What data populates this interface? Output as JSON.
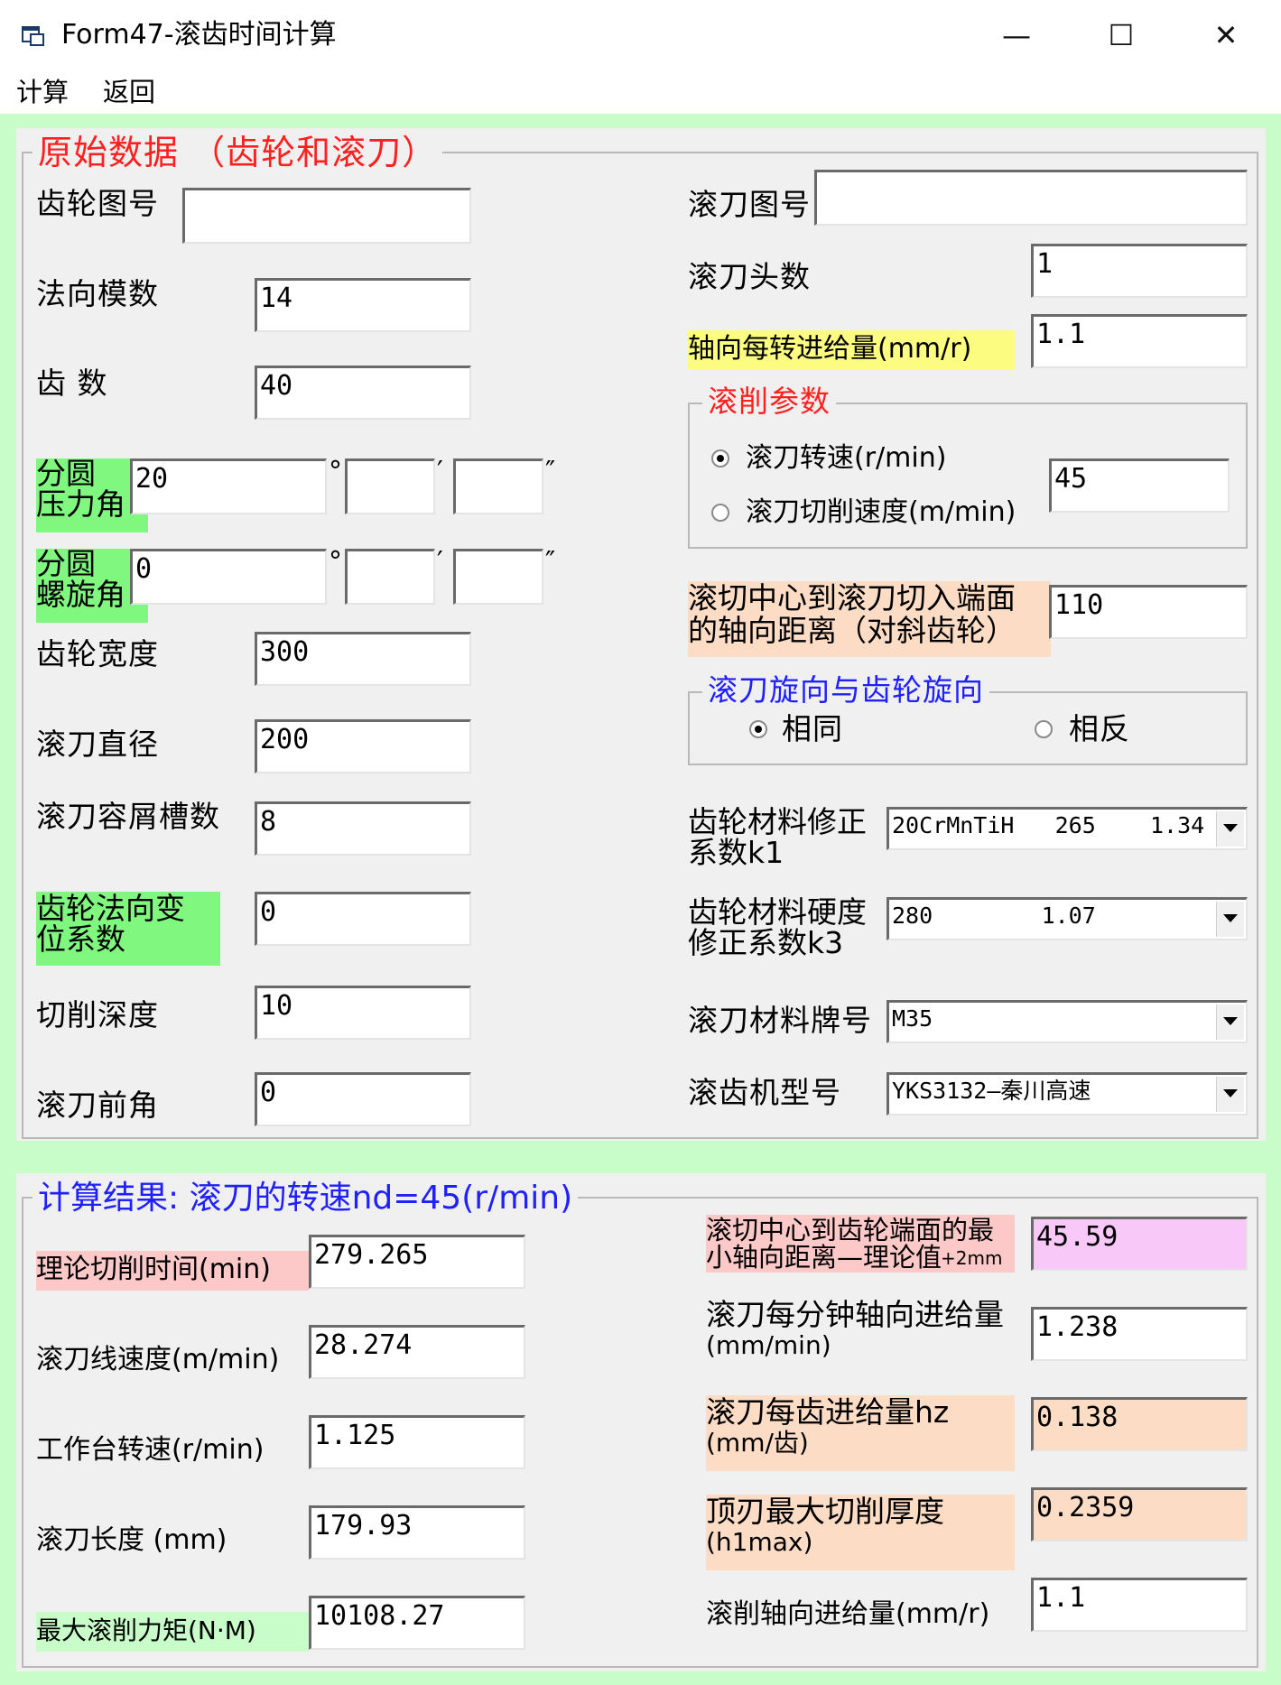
{
  "window": {
    "title": "Form47-滚齿时间计算",
    "minimize": "—",
    "maximize": "☐",
    "close": "✕"
  },
  "menu": {
    "calc": "计算",
    "back": "返回"
  },
  "source_group": {
    "legend": "原始数据  （齿轮和滚刀）",
    "left": {
      "gear_no_label": "齿轮图号",
      "gear_no": "",
      "module_label": "法向模数",
      "module": "14",
      "teeth_label": "齿    数",
      "teeth": "40",
      "pressure_label_1": "分圆",
      "pressure_label_2": "压力角",
      "pressure_deg": "20",
      "pressure_min": "",
      "pressure_sec": "",
      "helix_label_1": "分圆",
      "helix_label_2": "螺旋角",
      "helix_deg": "0",
      "helix_min": "",
      "helix_sec": "",
      "deg_sym": "°",
      "min_sym": "′",
      "sec_sym": "″",
      "width_label": "齿轮宽度",
      "width": "300",
      "hob_dia_label": "滚刀直径",
      "hob_dia": "200",
      "flutes_label": "滚刀容屑槽数",
      "flutes": "8",
      "shift_label_1": "齿轮法向变",
      "shift_label_2": "位系数",
      "shift": "0",
      "depth_label": "切削深度",
      "depth": "10",
      "rake_label": "滚刀前角",
      "rake": "0"
    },
    "right": {
      "hob_no_label": "滚刀图号",
      "hob_no": "",
      "starts_label": "滚刀头数",
      "starts": "1",
      "feed_label": "轴向每转进给量(mm/r)",
      "feed": "1.1",
      "cut_params": {
        "legend": "滚削参数",
        "opt_speed": "滚刀转速(r/min)",
        "opt_velocity": "滚刀切削速度(m/min)",
        "value": "45"
      },
      "approach_label_1": "滚切中心到滚刀切入端面",
      "approach_label_2": "的轴向距离（对斜齿轮）",
      "approach": "110",
      "direction": {
        "legend": "滚刀旋向与齿轮旋向",
        "same": "相同",
        "opposite": "相反"
      },
      "k1_label_1": "齿轮材料修正",
      "k1_label_2": "系数k1",
      "k1": "20CrMnTiH   265    1.34",
      "k3_label_1": "齿轮材料硬度",
      "k3_label_2": "修正系数k3",
      "k3": "280        1.07",
      "hob_mat_label": "滚刀材料牌号",
      "hob_mat": "M35",
      "machine_label": "滚齿机型号",
      "machine": "YKS3132—秦川高速"
    }
  },
  "result_group": {
    "legend": "计算结果:    滚刀的转速nd=45(r/min)",
    "left": {
      "time_label": "理论切削时间(min)",
      "time": "279.265",
      "speed_label": "滚刀线速度(m/min)",
      "speed": "28.274",
      "table_label": "工作台转速(r/min)",
      "table": "1.125",
      "length_label": "滚刀长度 (mm)",
      "length": "179.93",
      "torque_label": "最大滚削力矩(N·M)",
      "torque": "10108.27"
    },
    "right": {
      "min_dist_label_1": "滚切中心到齿轮端面的最",
      "min_dist_label_2": "小轴向距离—理论值",
      "min_dist_suffix": "+2mm",
      "min_dist": "45.59",
      "feed_min_label_1": "滚刀每分钟轴向进给量",
      "feed_min_label_2": "(mm/min)",
      "feed_min": "1.238",
      "hz_label_1": "滚刀每齿进给量hz",
      "hz_label_2": "(mm/齿)",
      "hz": "0.138",
      "h1_label_1": "顶刃最大切削厚度",
      "h1_label_2": "(h1max)",
      "h1": "0.2359",
      "axial_label": "滚削轴向进给量(mm/r)",
      "axial": "1.1"
    }
  }
}
